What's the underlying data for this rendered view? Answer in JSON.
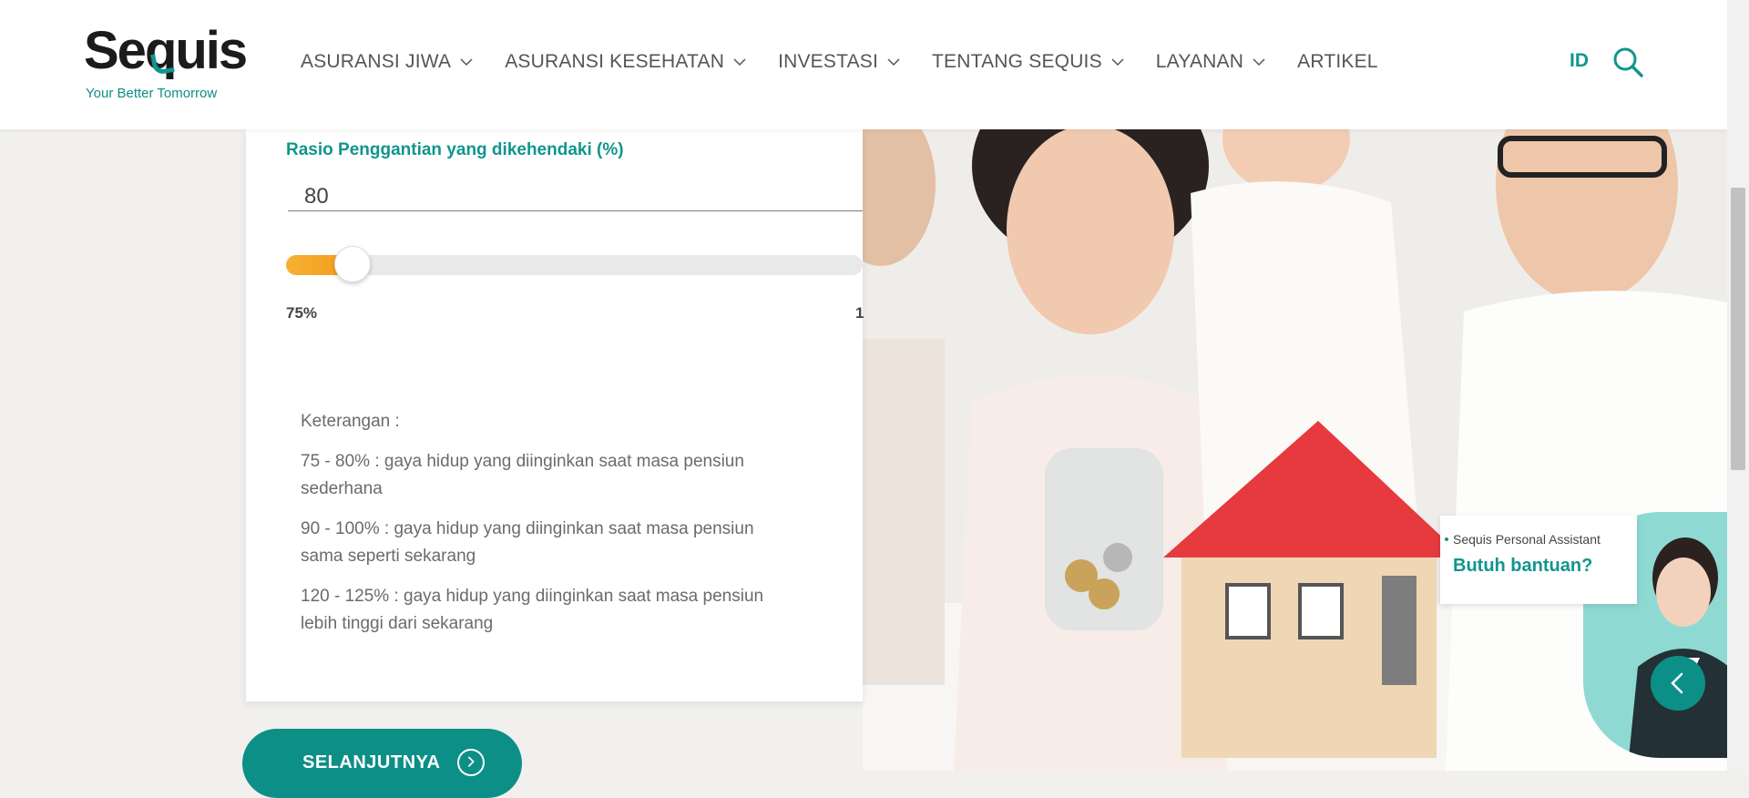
{
  "header": {
    "logo_text": "Sequis",
    "tagline": "Your Better Tomorrow",
    "nav": [
      {
        "label": "ASURANSI JIWA",
        "has_dropdown": true
      },
      {
        "label": "ASURANSI KESEHATAN",
        "has_dropdown": true
      },
      {
        "label": "INVESTASI",
        "has_dropdown": true
      },
      {
        "label": "TENTANG SEQUIS",
        "has_dropdown": true
      },
      {
        "label": "LAYANAN",
        "has_dropdown": true
      },
      {
        "label": "ARTIKEL",
        "has_dropdown": false
      }
    ],
    "language": "ID",
    "search_icon": "search-icon"
  },
  "form": {
    "ratio_label": "Rasio Penggantian yang dikehendaki (%)",
    "ratio_value": "80",
    "slider": {
      "min_label": "75%",
      "max_label": "1",
      "value": 80,
      "min": 75,
      "max": 125
    },
    "note_title": "Keterangan :",
    "notes": [
      "75 - 80% : gaya hidup yang diinginkan saat masa pensiun sederhana",
      "90 - 100% : gaya hidup yang diinginkan saat masa pensiun sama seperti sekarang",
      "120 - 125% : gaya hidup yang diinginkan saat masa pensiun lebih tinggi dari sekarang"
    ],
    "next_label": "SELANJUTNYA"
  },
  "assistant": {
    "title": "Sequis Personal Assistant",
    "help": "Butuh bantuan?"
  },
  "colors": {
    "brand": "#10958d",
    "slider_fill": "#f39c1b",
    "button": "#0c8f87"
  }
}
